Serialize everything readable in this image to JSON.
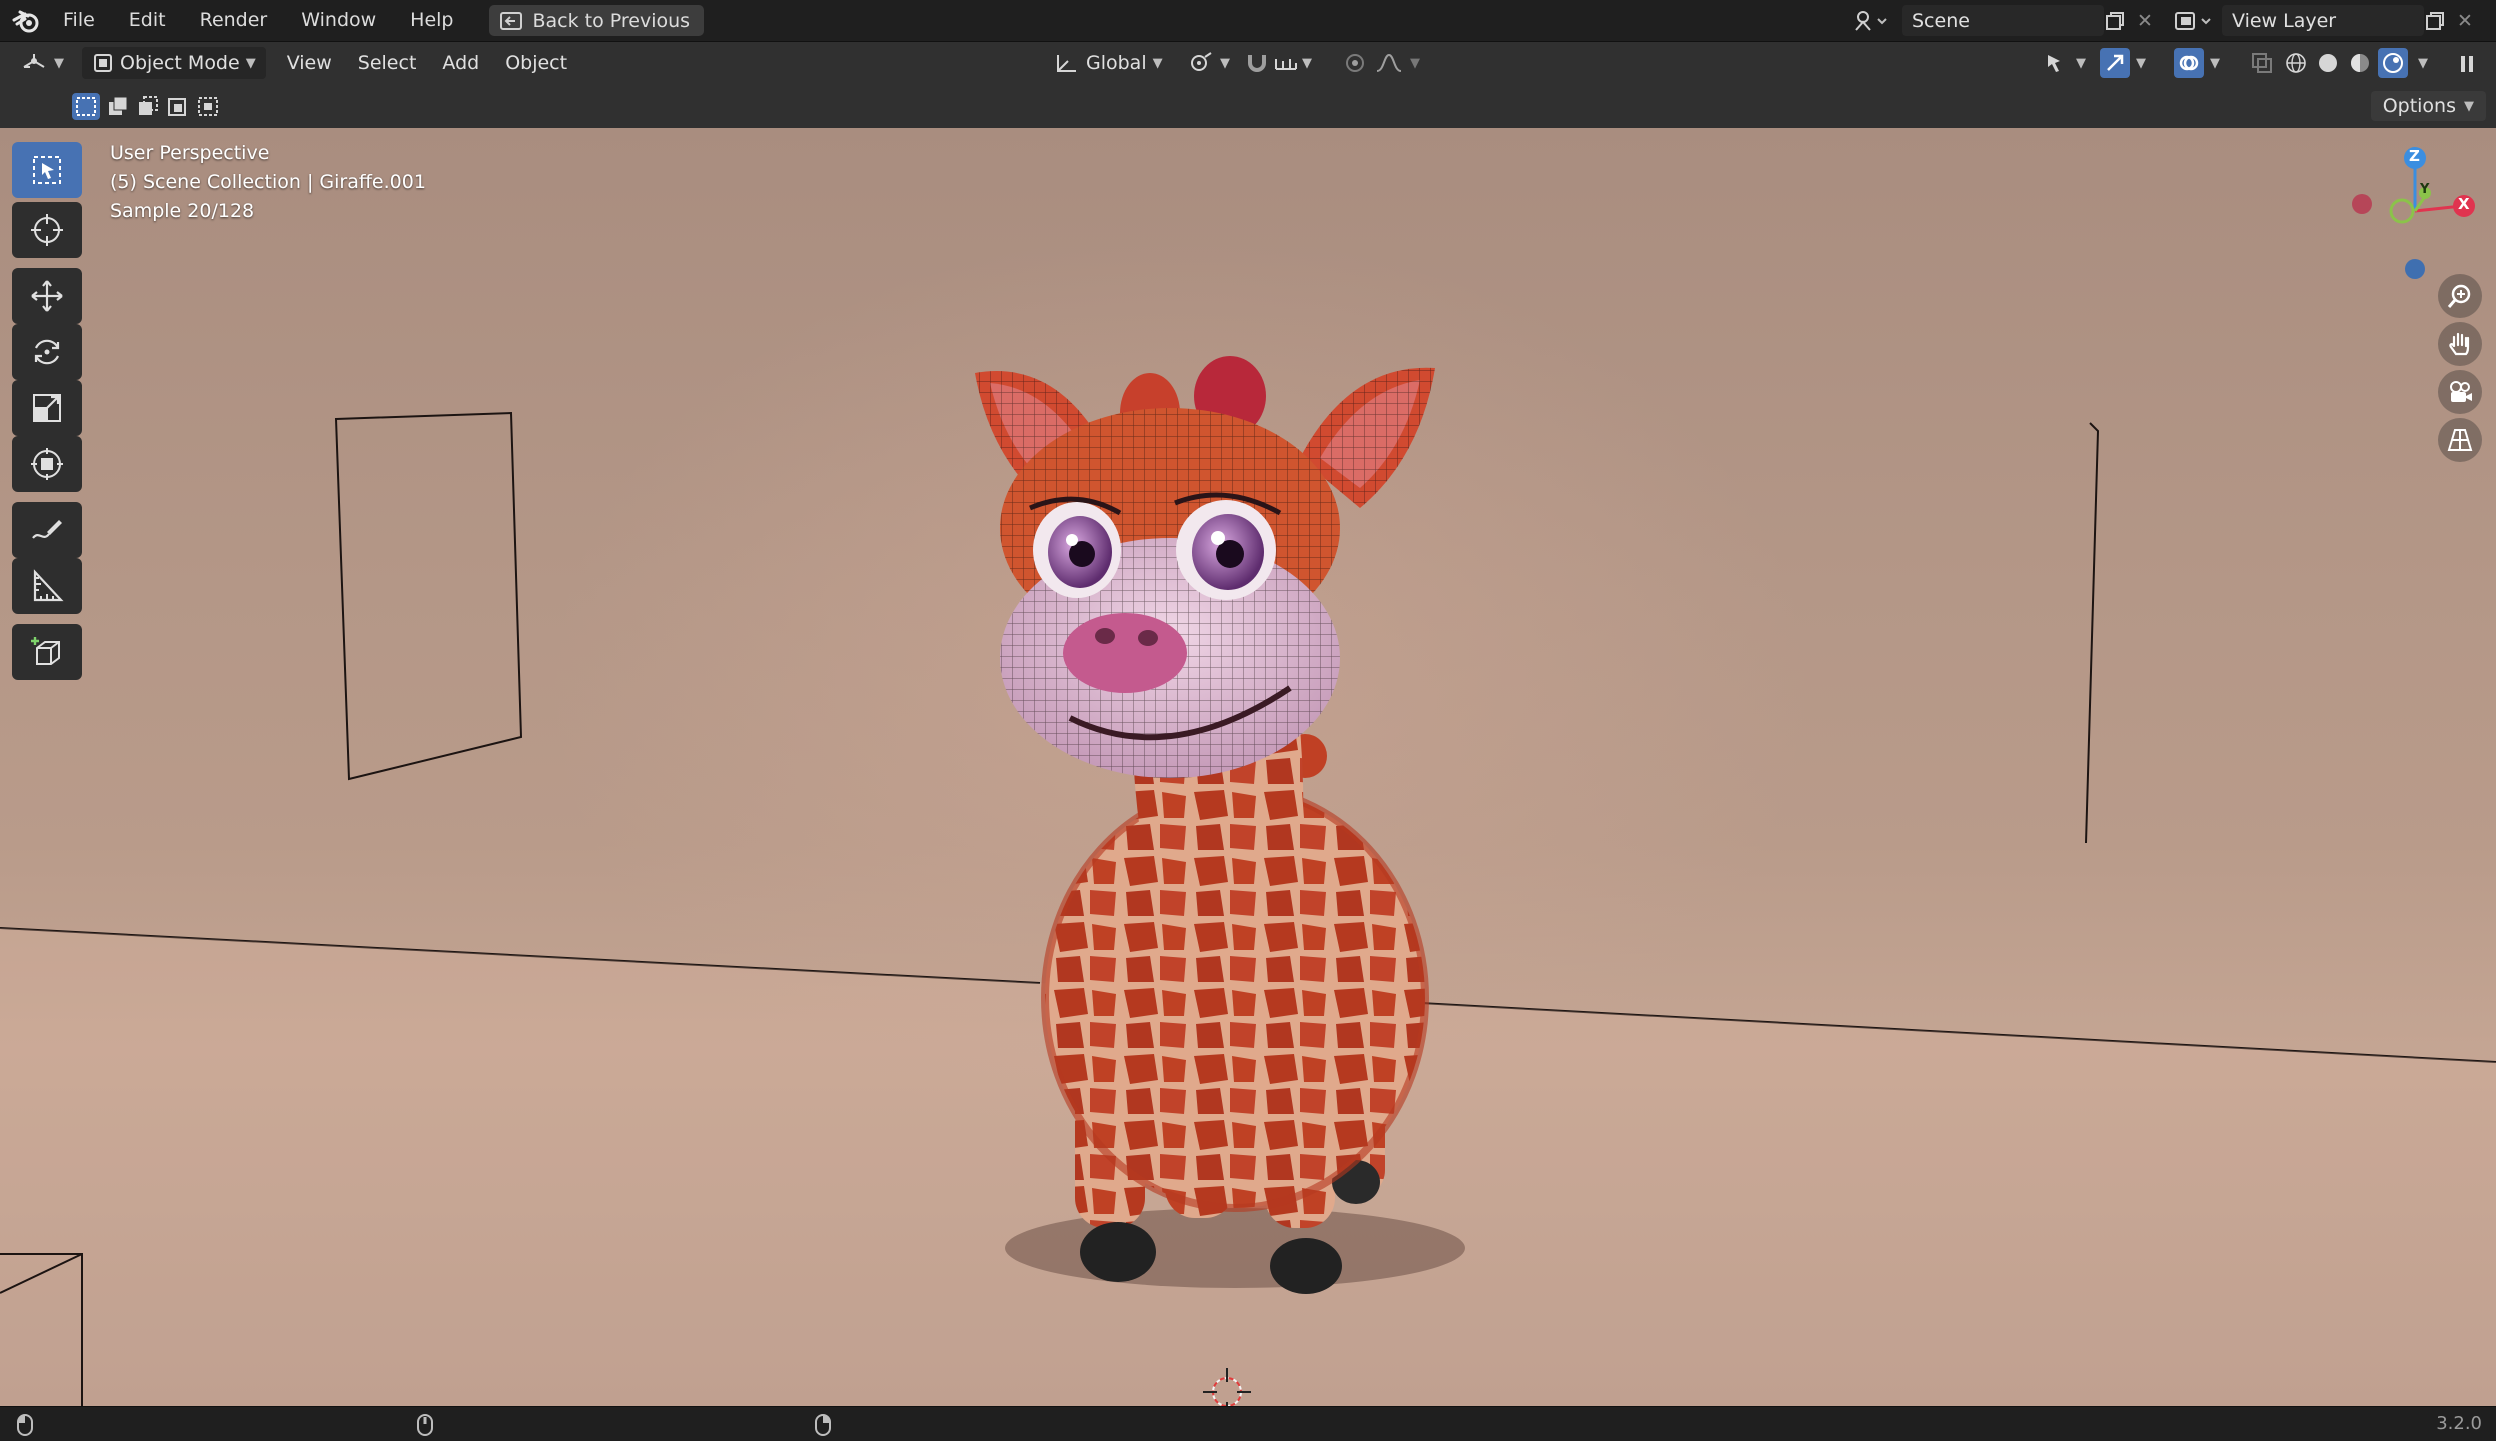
{
  "menu": {
    "items": [
      "File",
      "Edit",
      "Render",
      "Window",
      "Help"
    ],
    "back_button": "Back to Previous"
  },
  "scene": {
    "label": "Scene"
  },
  "view_layer": {
    "label": "View Layer"
  },
  "header": {
    "mode": "Object Mode",
    "menus": [
      "View",
      "Select",
      "Add",
      "Object"
    ],
    "orientation": "Global"
  },
  "tool_settings": {
    "options_label": "Options"
  },
  "viewport": {
    "perspective": "User Perspective",
    "collection_line": "(5) Scene Collection | Giraffe.001",
    "sample": "Sample 20/128"
  },
  "toolbar": {
    "tools": [
      "select-box",
      "cursor",
      "move",
      "rotate",
      "scale",
      "transform",
      "annotate",
      "measure",
      "add-cube"
    ]
  },
  "gizmo": {
    "axis_z": "Z",
    "axis_y": "Y",
    "axis_x": "X"
  },
  "status": {
    "version": "3.2.0"
  },
  "colors": {
    "accent": "#4772b3",
    "axis_x": "#e0344f",
    "axis_y": "#8bc34a",
    "axis_z": "#3b8ee0",
    "giraffe_fur": "#c24a2a"
  }
}
